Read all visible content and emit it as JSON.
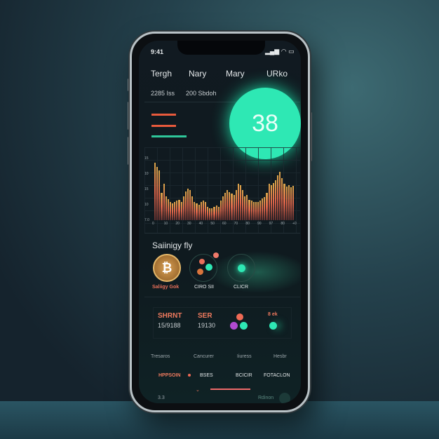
{
  "status_bar": {
    "time": "9:41"
  },
  "tabs": [
    "Tergh",
    "Nary",
    "Mary",
    "URko"
  ],
  "stats": {
    "left": "2285 Iss",
    "right": "200 Sbdoh"
  },
  "gauge": {
    "value": "38",
    "color": "#2ee8b4"
  },
  "legend": [
    {
      "label": "",
      "color": "#e85a3c"
    },
    {
      "label": "",
      "color": "#e85a3c"
    },
    {
      "label": "",
      "color": "#2fc79a"
    }
  ],
  "chart_data": {
    "type": "bar",
    "yticks": [
      "15",
      "10",
      "15",
      "10",
      "7.0"
    ],
    "xticks": [
      "0",
      "10",
      "20",
      "30",
      "40",
      "50",
      "60",
      "70",
      "80",
      "90",
      "97",
      "80",
      "+0"
    ],
    "values": [
      95,
      88,
      82,
      45,
      60,
      40,
      35,
      30,
      28,
      30,
      32,
      34,
      30,
      40,
      48,
      52,
      50,
      40,
      30,
      28,
      26,
      30,
      32,
      30,
      22,
      20,
      20,
      22,
      24,
      22,
      32,
      40,
      45,
      50,
      46,
      44,
      42,
      50,
      60,
      58,
      50,
      40,
      42,
      34,
      32,
      30,
      30,
      30,
      32,
      36,
      38,
      45,
      60,
      58,
      62,
      66,
      75,
      80,
      70,
      60,
      56,
      58,
      55,
      57
    ],
    "grid": true,
    "bar_color": "#e0664a"
  },
  "section": {
    "title": "Saiinigy fly"
  },
  "assets": [
    {
      "label": "Saliigy Gok",
      "icon": "bitcoin-icon"
    },
    {
      "label": "CIRO SII",
      "icon": "orbit-icon"
    },
    {
      "label": "CLICR",
      "icon": "orbit-icon"
    }
  ],
  "summary": {
    "a_title": "SHRNT",
    "a_value": "15/9188",
    "b_title": "SER",
    "b_value": "19130",
    "c_title": "8 ek"
  },
  "bottom_labels": [
    "Tresaros",
    "Cancurer",
    "Iiuress",
    "Hesbr"
  ],
  "bottom_nav": [
    "HPPSOIN",
    "BSES",
    "BCICIR",
    "FOTACLON"
  ],
  "footer": {
    "left": "3.3",
    "right": "Rdinon"
  }
}
